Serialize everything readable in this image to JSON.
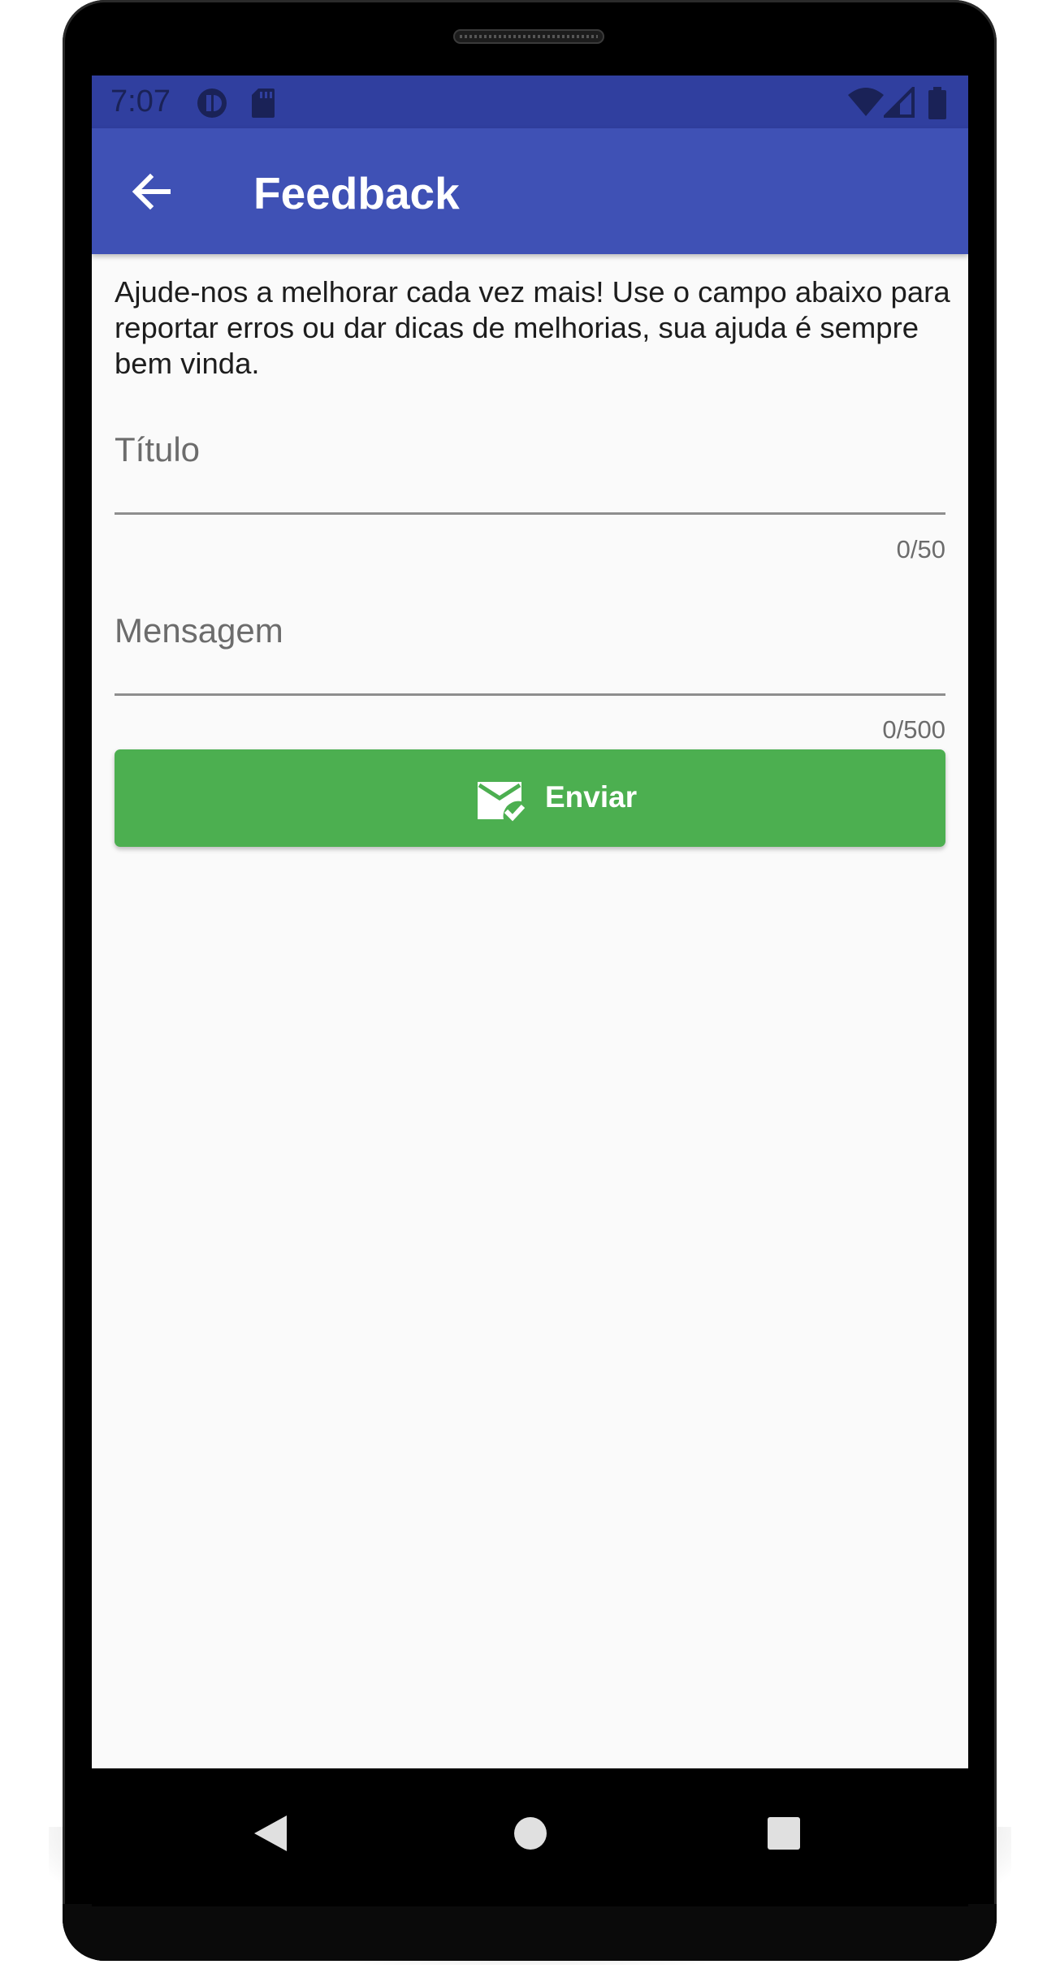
{
  "status_bar": {
    "time": "7:07",
    "icons": [
      "alert-circle-icon",
      "sd-card-icon",
      "wifi-icon",
      "signal-icon",
      "battery-icon"
    ],
    "bg_color": "#303f9f"
  },
  "app_bar": {
    "title": "Feedback",
    "back_icon": "arrow-back-icon",
    "bg_color": "#3f51b5"
  },
  "form": {
    "intro": "Ajude-nos a melhorar cada vez mais! Use o campo abaixo para reportar erros ou dar dicas de melhorias, sua ajuda é sempre bem vinda.",
    "title_field": {
      "placeholder": "Título",
      "value": "",
      "counter": "0/50"
    },
    "message_field": {
      "placeholder": "Mensagem",
      "value": "",
      "counter": "0/500"
    },
    "submit": {
      "label": "Enviar",
      "icon": "mail-check-icon",
      "color": "#4caf50"
    }
  },
  "nav_bar": {
    "buttons": [
      "back-triangle-icon",
      "home-circle-icon",
      "recents-square-icon"
    ]
  }
}
